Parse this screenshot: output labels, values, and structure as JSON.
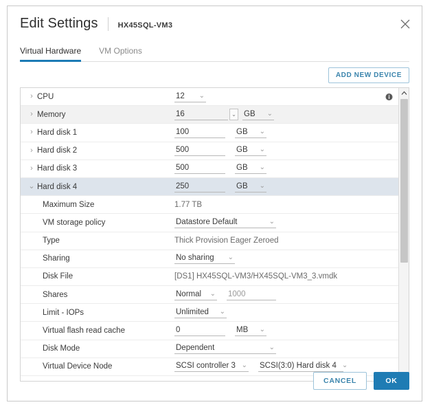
{
  "colors": {
    "accent": "#1b7bb5",
    "primary_button_bg": "#1f7cb4",
    "link_blue": "#3a84ac",
    "row_alt_bg": "#f2f2f2",
    "row_selected_bg": "#dde4ec"
  },
  "header": {
    "title": "Edit Settings",
    "object_name": "HX45SQL-VM3",
    "close_label": "Close"
  },
  "tabs": [
    {
      "label": "Virtual Hardware",
      "active": true
    },
    {
      "label": "VM Options",
      "active": false
    }
  ],
  "toolbar": {
    "add_new_device_label": "ADD NEW DEVICE"
  },
  "device_rows": [
    {
      "label": "CPU",
      "caret": "collapsed",
      "value": "12",
      "control": "select",
      "has_info_icon": true
    },
    {
      "label": "Memory",
      "caret": "collapsed",
      "value": "16",
      "control": "input_spinner_unit",
      "unit": "GB"
    },
    {
      "label": "Hard disk 1",
      "caret": "collapsed",
      "value": "100",
      "control": "input_unit",
      "unit": "GB"
    },
    {
      "label": "Hard disk 2",
      "caret": "collapsed",
      "value": "500",
      "control": "input_unit",
      "unit": "GB"
    },
    {
      "label": "Hard disk 3",
      "caret": "collapsed",
      "value": "500",
      "control": "input_unit",
      "unit": "GB"
    },
    {
      "label": "Hard disk 4",
      "caret": "expanded",
      "value": "250",
      "control": "input_unit",
      "unit": "GB",
      "selected": true
    }
  ],
  "disk_detail_rows": [
    {
      "label": "Maximum Size",
      "control": "text",
      "value": "1.77 TB"
    },
    {
      "label": "VM storage policy",
      "control": "select",
      "value": "Datastore Default"
    },
    {
      "label": "Type",
      "control": "text",
      "value": "Thick Provision Eager Zeroed"
    },
    {
      "label": "Sharing",
      "control": "select",
      "value": "No sharing"
    },
    {
      "label": "Disk File",
      "control": "text",
      "value": "[DS1] HX45SQL-VM3/HX45SQL-VM3_3.vmdk"
    },
    {
      "label": "Shares",
      "control": "select_plus_input",
      "value": "Normal",
      "value2": "1000"
    },
    {
      "label": "Limit - IOPs",
      "control": "select",
      "value": "Unlimited"
    },
    {
      "label": "Virtual flash read cache",
      "control": "input_unit",
      "value": "0",
      "unit": "MB"
    },
    {
      "label": "Disk Mode",
      "control": "select",
      "value": "Dependent"
    },
    {
      "label": "Virtual Device Node",
      "control": "select_pair",
      "value": "SCSI controller 3",
      "value2": "SCSI(3:0) Hard disk 4"
    }
  ],
  "footer": {
    "cancel_label": "CANCEL",
    "ok_label": "OK"
  },
  "icons": {
    "caret_collapsed": "›",
    "caret_expanded": "⌄",
    "chevron_down": "⌄",
    "scroll_up": "建",
    "scroll_down": "建"
  }
}
